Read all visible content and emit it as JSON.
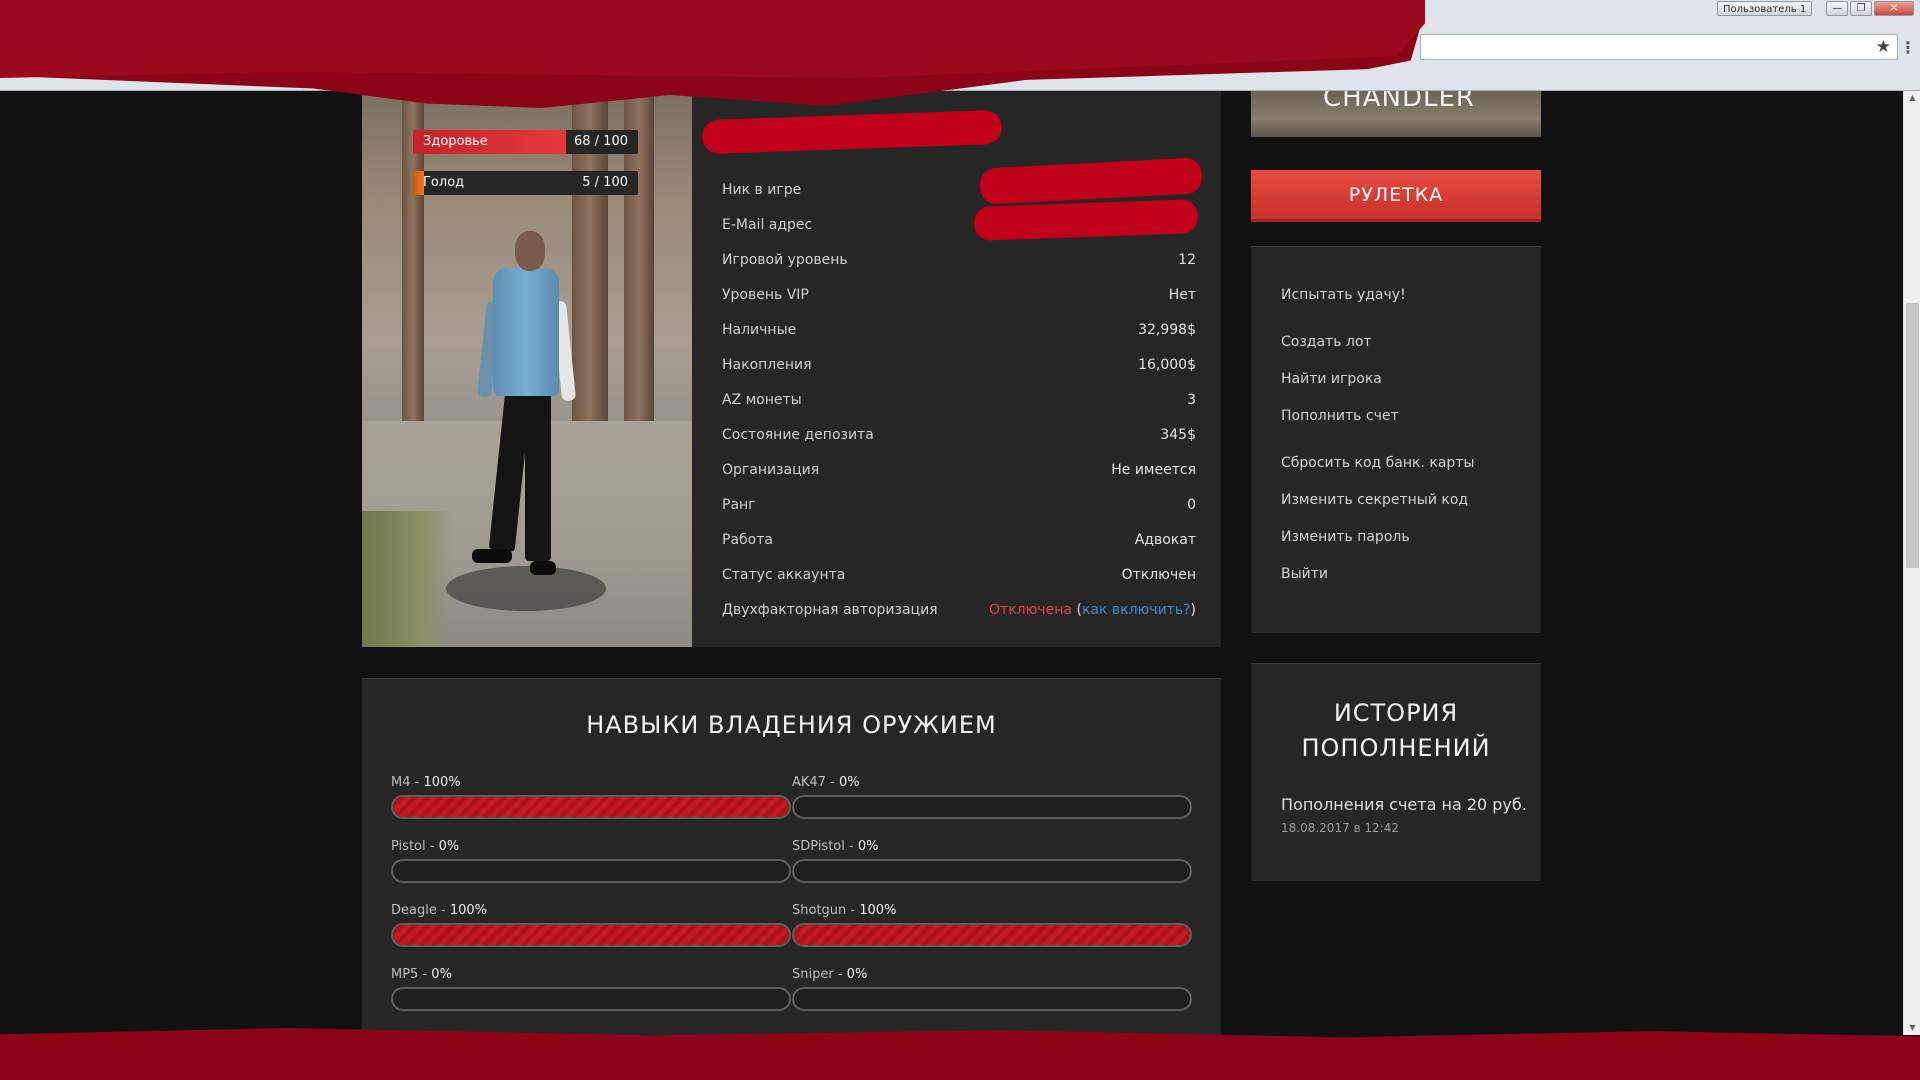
{
  "browser": {
    "user_label": "Пользователь 1",
    "window_controls": [
      "—",
      "❐",
      "✕"
    ],
    "star_icon": "★",
    "menu_icon": "⋮"
  },
  "profile": {
    "stats": {
      "health_label": "Здоровье",
      "health_value": "68 / 100",
      "health_fraction": 0.68,
      "hunger_label": "Голод",
      "hunger_value": "5 / 100",
      "hunger_fraction": 0.05
    },
    "info": [
      {
        "label": "Ник в игре",
        "value": ""
      },
      {
        "label": "E-Mail адрес",
        "value": ""
      },
      {
        "label": "Игровой уровень",
        "value": "12"
      },
      {
        "label": "Уровень VIP",
        "value": "Нет"
      },
      {
        "label": "Наличные",
        "value": "32,998$"
      },
      {
        "label": "Накопления",
        "value": "16,000$"
      },
      {
        "label": "AZ монеты",
        "value": "3"
      },
      {
        "label": "Состояние депозита",
        "value": "345$"
      },
      {
        "label": "Организация",
        "value": "Не имеется"
      },
      {
        "label": "Ранг",
        "value": "0"
      },
      {
        "label": "Работа",
        "value": "Адвокат"
      },
      {
        "label": "Статус аккаунта",
        "value": "Отключен"
      }
    ],
    "two_factor": {
      "label": "Двухфакторная авторизация",
      "status": "Отключена",
      "open_paren": "(",
      "link": "как включить?",
      "close_paren": ")"
    }
  },
  "weapons": {
    "title": "НАВЫКИ ВЛАДЕНИЯ ОРУЖИЕМ",
    "skills": [
      {
        "name": "M4",
        "percent_label": "100%",
        "value": 100
      },
      {
        "name": "AK47",
        "percent_label": "0%",
        "value": 0
      },
      {
        "name": "Pistol",
        "percent_label": "0%",
        "value": 0
      },
      {
        "name": "SDPistol",
        "percent_label": "0%",
        "value": 0
      },
      {
        "name": "Deagle",
        "percent_label": "100%",
        "value": 100
      },
      {
        "name": "Shotgun",
        "percent_label": "100%",
        "value": 100
      },
      {
        "name": "MP5",
        "percent_label": "0%",
        "value": 0
      },
      {
        "name": "Sniper",
        "percent_label": "0%",
        "value": 0
      }
    ]
  },
  "sidebar": {
    "image_text": "CHANDLER",
    "roulette_label": "РУЛЕТКА",
    "menu": [
      "Испытать удачу!",
      "Создать лот",
      "Найти игрока",
      "Пополнить счет",
      "Сбросить код банк. карты",
      "Изменить секретный код",
      "Изменить пароль",
      "Выйти"
    ],
    "history": {
      "title_line1": "ИСТОРИЯ",
      "title_line2": "ПОПОЛНЕНИЙ",
      "entry": "Пополнения счета на 20 руб.",
      "date": "18.08.2017 в 12:42"
    }
  },
  "colors": {
    "accent_red": "#e0453f",
    "link_blue": "#3f8ac9",
    "scribble_red": "#8c0418"
  }
}
